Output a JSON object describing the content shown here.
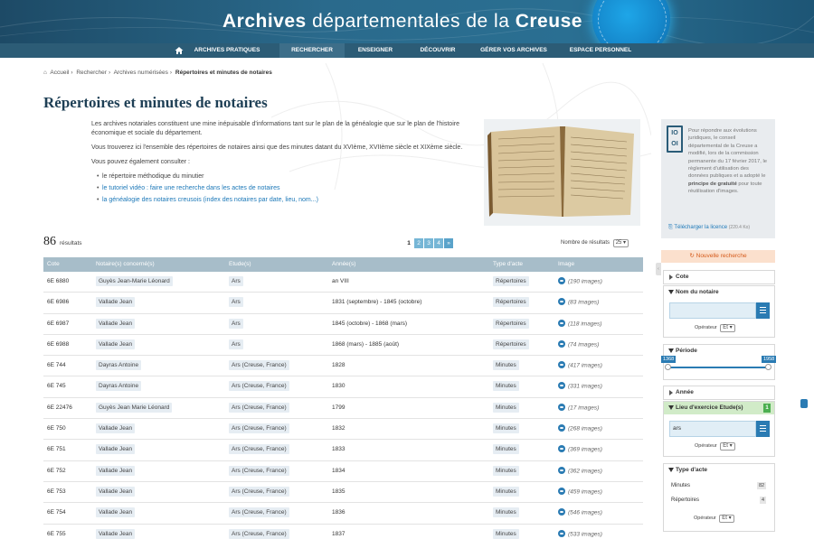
{
  "header": {
    "title_part1": "Archives",
    "title_part2": "départementales de la",
    "title_part3": "Creuse"
  },
  "nav": {
    "items": [
      "ARCHIVES PRATIQUES",
      "RECHERCHER",
      "ENSEIGNER",
      "DÉCOUVRIR",
      "GÉRER VOS ARCHIVES",
      "ESPACE PERSONNEL"
    ],
    "active": "RECHERCHER"
  },
  "breadcrumb": [
    "Accueil",
    "Rechercher",
    "Archives numérisées",
    "Répertoires et minutes de notaires"
  ],
  "page_title": "Répertoires et minutes de notaires",
  "intro": {
    "p1": "Les archives notariales constituent une mine inépuisable d'informations tant sur le plan de la généalogie que sur le plan de l'histoire économique et sociale du département.",
    "p2": "Vous trouverez ici l'ensemble des répertoires de notaires ainsi que des minutes datant du XVIème, XVIIème siècle et XIXème siècle.",
    "p3": "Vous pouvez également consulter :",
    "list": [
      "le répertoire méthodique du minutier",
      "le tutoriel vidéo : faire une recherche dans les actes de notaires",
      "la généalogie des notaires creusois (index des notaires par date, lieu, nom...)"
    ]
  },
  "results": {
    "count": "86",
    "label": "résultats",
    "pages": [
      "1",
      "2",
      "3",
      "4"
    ],
    "next": "»",
    "per_page_label": "Nombre de résultats",
    "per_page": "25"
  },
  "table": {
    "headers": [
      "Cote",
      "Notaire(s) concerné(s)",
      "Etude(s)",
      "Année(s)",
      "Type d'acte",
      "Image"
    ],
    "rows": [
      {
        "cote": "6E 6880",
        "notaire": "Guyès Jean-Marie Léonard",
        "etude": "Ars",
        "annee": "an VIII",
        "type": "Répertoires",
        "image": "(190 images)"
      },
      {
        "cote": "6E 6986",
        "notaire": "Vallade Jean",
        "etude": "Ars",
        "annee": "1831 (septembre) - 1845 (octobre)",
        "type": "Répertoires",
        "image": "(83 images)"
      },
      {
        "cote": "6E 6987",
        "notaire": "Vallade Jean",
        "etude": "Ars",
        "annee": "1845 (octobre) - 1868 (mars)",
        "type": "Répertoires",
        "image": "(118 images)"
      },
      {
        "cote": "6E 6988",
        "notaire": "Vallade Jean",
        "etude": "Ars",
        "annee": "1868 (mars) - 1885 (août)",
        "type": "Répertoires",
        "image": "(74 images)"
      },
      {
        "cote": "6E 744",
        "notaire": "Dayras Antoine",
        "etude": "Ars (Creuse, France)",
        "annee": "1828",
        "type": "Minutes",
        "image": "(417 images)"
      },
      {
        "cote": "6E 745",
        "notaire": "Dayras Antoine",
        "etude": "Ars (Creuse, France)",
        "annee": "1830",
        "type": "Minutes",
        "image": "(331 images)"
      },
      {
        "cote": "6E 22476",
        "notaire": "Guyès Jean Marie Léonard",
        "etude": "Ars (Creuse, France)",
        "annee": "1799",
        "type": "Minutes",
        "image": "(17 images)"
      },
      {
        "cote": "6E 750",
        "notaire": "Vallade Jean",
        "etude": "Ars (Creuse, France)",
        "annee": "1832",
        "type": "Minutes",
        "image": "(268 images)"
      },
      {
        "cote": "6E 751",
        "notaire": "Vallade Jean",
        "etude": "Ars (Creuse, France)",
        "annee": "1833",
        "type": "Minutes",
        "image": "(369 images)"
      },
      {
        "cote": "6E 752",
        "notaire": "Vallade Jean",
        "etude": "Ars (Creuse, France)",
        "annee": "1834",
        "type": "Minutes",
        "image": "(362 images)"
      },
      {
        "cote": "6E 753",
        "notaire": "Vallade Jean",
        "etude": "Ars (Creuse, France)",
        "annee": "1835",
        "type": "Minutes",
        "image": "(459 images)"
      },
      {
        "cote": "6E 754",
        "notaire": "Vallade Jean",
        "etude": "Ars (Creuse, France)",
        "annee": "1836",
        "type": "Minutes",
        "image": "(546 images)"
      },
      {
        "cote": "6E 755",
        "notaire": "Vallade Jean",
        "etude": "Ars (Creuse, France)",
        "annee": "1837",
        "type": "Minutes",
        "image": "(533 images)"
      }
    ]
  },
  "licence": {
    "logo": "IO OI",
    "text_a": "Pour répondre aux évolutions juridiques, le conseil départemental de la Creuse a modifié, lors de la commission permanente du 17 février 2017, le règlement d'utilisation des données publiques et a adopté le",
    "text_b": "principe de gratuité",
    "text_c": "pour toute réutilisation d'images.",
    "download": "Télécharger la licence",
    "size": "(220.4 Ko)"
  },
  "new_search": "Nouvelle recherche",
  "facets": {
    "cote": "Cote",
    "nom_notaire": "Nom du notaire",
    "operateur": "Opérateur",
    "op_value": "Et",
    "periode": "Période",
    "periode_min": "1368",
    "periode_max": "1958",
    "annee": "Année",
    "lieu": "Lieu d'exercice Etude(s)",
    "lieu_count": "1",
    "lieu_value": "ars",
    "type_acte": "Type d'acte",
    "types": [
      {
        "label": "Minutes",
        "count": "82"
      },
      {
        "label": "Répertoires",
        "count": "4"
      }
    ]
  },
  "colors": {
    "banner": "#2a6a8c",
    "nav": "#2c5c76",
    "accent": "#2a7bb3",
    "table_header": "#a7bdc9",
    "new_search_bg": "#fbe0cd"
  }
}
